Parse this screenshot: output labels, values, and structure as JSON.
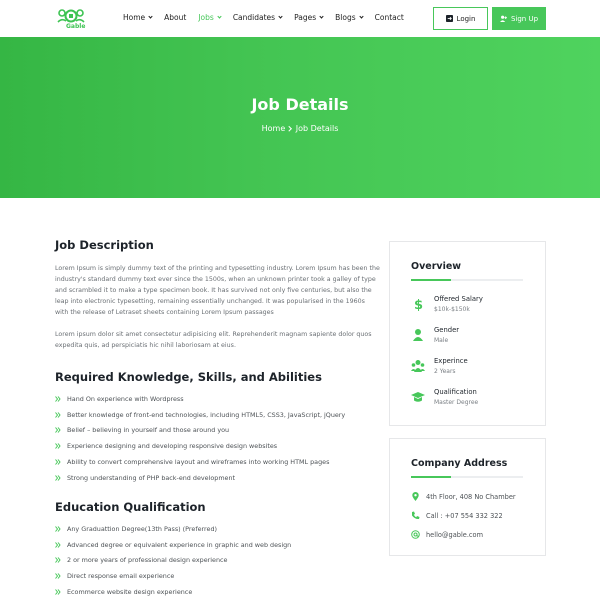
{
  "header": {
    "logo_text": "Gable",
    "menu": [
      {
        "label": "Home",
        "dropdown": true,
        "active": false
      },
      {
        "label": "About",
        "dropdown": false,
        "active": false
      },
      {
        "label": "Jobs",
        "dropdown": true,
        "active": true
      },
      {
        "label": "Candidates",
        "dropdown": true,
        "active": false
      },
      {
        "label": "Pages",
        "dropdown": true,
        "active": false
      },
      {
        "label": "Blogs",
        "dropdown": true,
        "active": false
      },
      {
        "label": "Contact",
        "dropdown": false,
        "active": false
      }
    ],
    "login_label": "Login",
    "signup_label": "Sign Up"
  },
  "hero": {
    "title": "Job Details",
    "breadcrumb_home": "Home",
    "breadcrumb_current": "Job Details"
  },
  "main": {
    "job_description": {
      "title": "Job Description",
      "paragraphs": [
        "Lorem Ipsum is simply dummy text of the printing and typesetting industry. Lorem Ipsum has been the industry's standard dummy text ever since the 1500s, when an unknown printer took a galley of type and scrambled it to make a type specimen book. It has survived not only five centuries, but also the leap into electronic typesetting, remaining essentially unchanged. It was popularised in the 1960s with the release of Letraset sheets containing Lorem Ipsum passages",
        "Lorem ipsum dolor sit amet consectetur adipisicing elit. Reprehenderit magnam sapiente dolor quos expedita quis, ad perspiciatis hic nihil laboriosam at eius."
      ]
    },
    "knowledge": {
      "title": "Required Knowledge, Skills, and Abilities",
      "items": [
        "Hand On experience with Wordpress",
        "Better knowledge of front-end technologies, including HTML5, CSS3, JavaScript, jQuery",
        "Belief – believing in yourself and those around you",
        "Experience designing and developing responsive design websites",
        "Ability to convert comprehensive layout and wireframes into working HTML pages",
        "Strong understanding of PHP back-end development"
      ]
    },
    "education": {
      "title": "Education Qualification",
      "items": [
        "Any Graduattion Degree(13th Pass) (Preferred)",
        "Advanced degree or equivalent experience in graphic and web design",
        "2 or more years of professional design experience",
        "Direct response email experience",
        "Ecommerce website design experience"
      ]
    }
  },
  "sidebar": {
    "overview": {
      "title": "Overview",
      "items": [
        {
          "label": "Offered Salary",
          "value": "$10k-$150k",
          "icon": "dollar-icon"
        },
        {
          "label": "Gender",
          "value": "Male",
          "icon": "gender-icon"
        },
        {
          "label": "Experince",
          "value": "2 Years",
          "icon": "experience-icon"
        },
        {
          "label": "Qualification",
          "value": "Master Degree",
          "icon": "graduation-cap-icon"
        }
      ]
    },
    "address": {
      "title": "Company Address",
      "location": "4th Floor, 408 No Chamber",
      "phone": "Call : +07 554 332 322",
      "email": "hello@gable.com"
    }
  },
  "colors": {
    "accent": "#47c75a",
    "hero_start": "#35b644",
    "hero_end": "#4fd35e",
    "heading": "#1d232a",
    "body_text": "#6b7075"
  }
}
